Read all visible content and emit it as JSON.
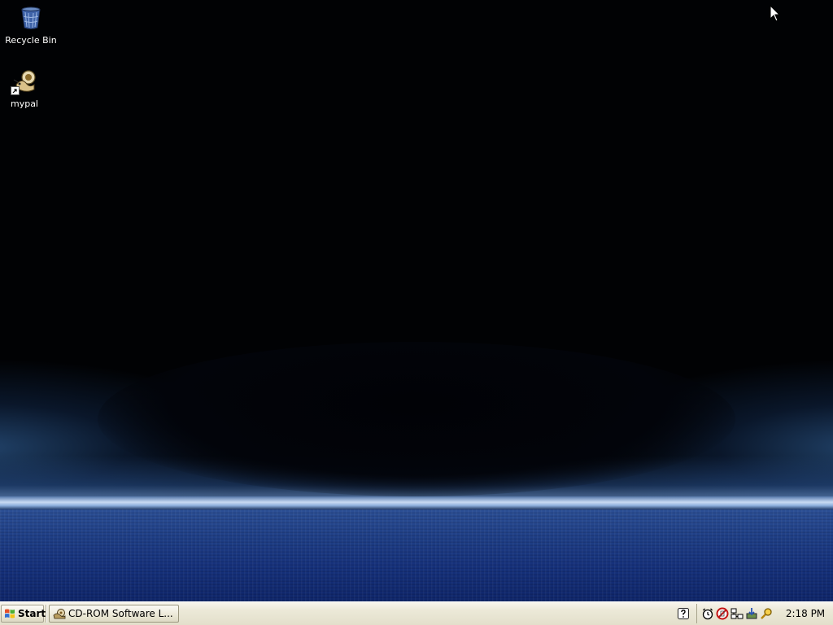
{
  "desktop": {
    "wallpaper": {
      "sky_color": "#010204",
      "sea_color": "#1f3f86",
      "horizon_color": "#c8daf3"
    },
    "icons": [
      {
        "label": "Recycle Bin",
        "icon": "recycle-bin-icon"
      },
      {
        "label": "mypal",
        "icon": "mypal-icon",
        "shortcut": true
      }
    ]
  },
  "taskbar": {
    "start_label": "Start",
    "tasks": [
      {
        "label": "CD-ROM Software L...",
        "icon": "cd-software-icon"
      }
    ],
    "quick_help_icon": "help-icon",
    "tray": {
      "icons": [
        "clock-alarm-icon",
        "no-entry-icon",
        "network-icon",
        "install-icon",
        "search-key-icon"
      ],
      "clock": "2:18 PM"
    }
  }
}
